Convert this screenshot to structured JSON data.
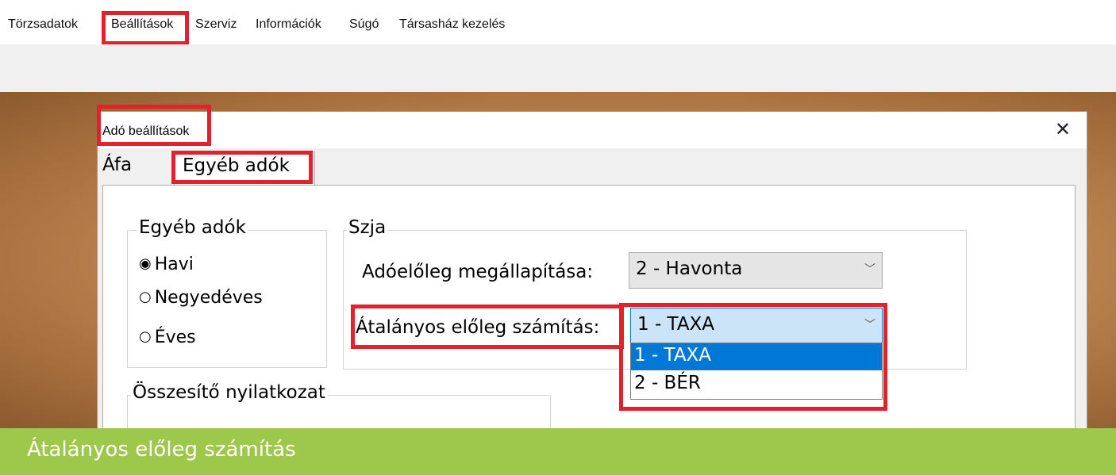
{
  "menu": {
    "items": [
      {
        "label": "Törzsadatok"
      },
      {
        "label": "Beállítások"
      },
      {
        "label": "Szerviz"
      },
      {
        "label": "Információk"
      },
      {
        "label": "Súgó"
      },
      {
        "label": "Társasház kezelés"
      }
    ],
    "highlighted": "Beállítások"
  },
  "dialog": {
    "title": "Adó beállítások",
    "close_symbol": "✕",
    "tabs": [
      {
        "label": "Áfa"
      },
      {
        "label": "Egyéb adók",
        "active": true
      }
    ],
    "period_group": {
      "label": "Egyéb adók",
      "options": [
        {
          "label": "Havi",
          "selected": true,
          "mark": "◉"
        },
        {
          "label": "Negyedéves",
          "selected": false,
          "mark": "○"
        },
        {
          "label": "Éves",
          "selected": false,
          "mark": "○"
        }
      ]
    },
    "szja_group": {
      "label": "Szja",
      "advance_label": "Adóelőleg megállapítása:",
      "advance_value": "2 - Havonta",
      "flat_label": "Átalányos előleg számítás:",
      "flat_value": "1 - TAXA",
      "flat_options": [
        {
          "label": "1 - TAXA",
          "selected": true
        },
        {
          "label": "2 - BÉR",
          "selected": false
        }
      ],
      "chevron": "﹀"
    },
    "summary_group": {
      "label": "Összesítő nyilatkozat"
    }
  },
  "caption": "Átalányos előleg számítás",
  "colors": {
    "highlight": "#e3202b",
    "caption_bar": "#9dc84b",
    "selected_option": "#0078d7",
    "combo_selected_bg": "#cce4f7"
  }
}
